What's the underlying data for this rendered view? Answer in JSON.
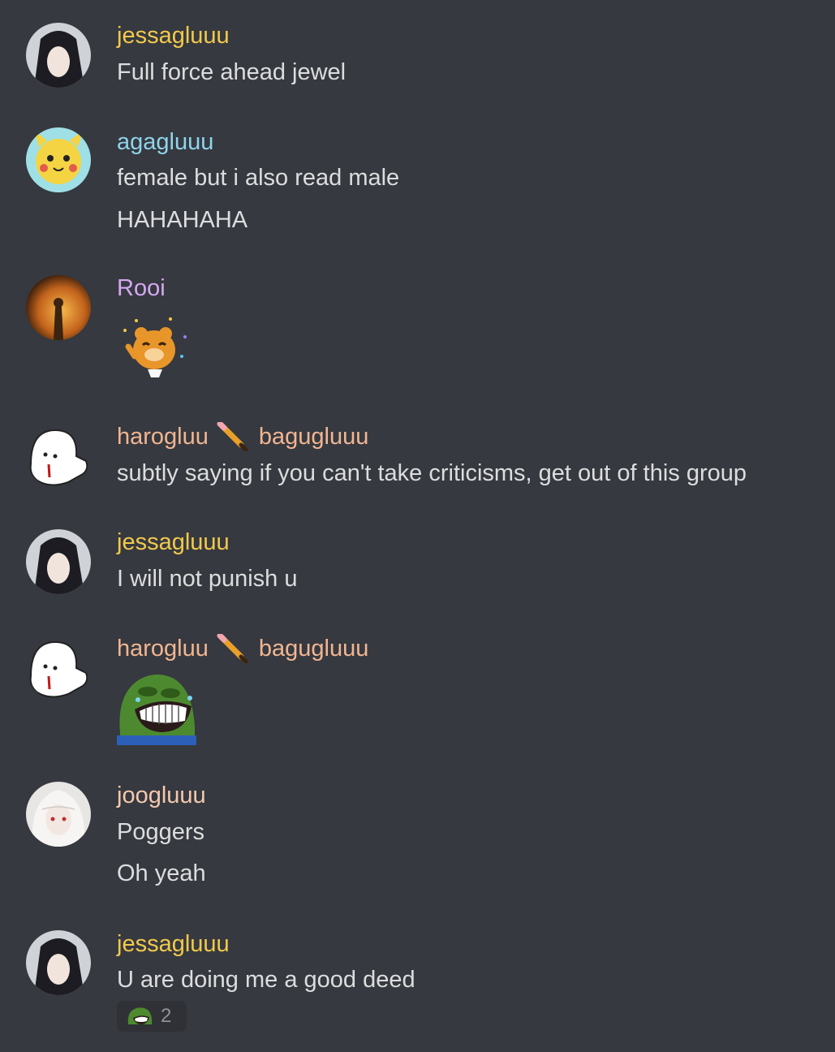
{
  "colors": {
    "background": "#36393f",
    "jessa": "#f2c94c",
    "aga": "#8fd3ec",
    "rooi": "#d4a8f2",
    "haro": "#f1b592",
    "joo": "#f4c9ae",
    "text": "#dcddde"
  },
  "messages": [
    {
      "author": "jessagluuu",
      "avatar": "anime-dark-hair-avatar",
      "lines": [
        "Full force ahead jewel"
      ]
    },
    {
      "author": "agagluuu",
      "avatar": "pikachu-avatar",
      "lines": [
        "female but i also read male",
        "HAHAHAHA"
      ]
    },
    {
      "author": "Rooi",
      "avatar": "sunset-avatar",
      "sticker": "laughing-bear-sticker"
    },
    {
      "author": "harogluu",
      "author2": "bagugluuu",
      "separator_icon": "pencil-icon",
      "avatar": "ghost-avatar",
      "lines": [
        "subtly saying if you can't take criticisms, get out of this group"
      ]
    },
    {
      "author": "jessagluuu",
      "avatar": "anime-dark-hair-avatar",
      "lines": [
        "I will not punish u"
      ]
    },
    {
      "author": "harogluu",
      "author2": "bagugluuu",
      "separator_icon": "pencil-icon",
      "avatar": "ghost-avatar",
      "emoji": "pepe-laugh-emoji"
    },
    {
      "author": "joogluuu",
      "avatar": "white-hair-avatar",
      "lines": [
        "Poggers",
        "Oh yeah"
      ]
    },
    {
      "author": "jessagluuu",
      "avatar": "anime-dark-hair-avatar",
      "lines": [
        "U are doing me a good deed"
      ],
      "reaction": {
        "emoji": "pepe-laugh-emoji",
        "count": "2"
      }
    }
  ]
}
